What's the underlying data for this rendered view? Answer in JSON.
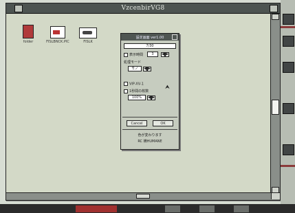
{
  "window": {
    "title": "VzcenbirVG8"
  },
  "desktop_icons": [
    {
      "label": "folder",
      "icon": "folder-icon"
    },
    {
      "label": "FISLBNCK.PIC",
      "icon": "document-icon"
    },
    {
      "label": "FISLK",
      "icon": "image-icon"
    }
  ],
  "dialog": {
    "title": "設定画面 ver1.00",
    "top_field": "7/30",
    "fields": {
      "field1_label": "表示時間",
      "field1_value": "3",
      "section_label": "処理モード",
      "mode_value": "モノ",
      "opt_a_label": "VIP-XV-1",
      "opt_b_label": "1秒間の枚数",
      "opt_b_value": "100%"
    },
    "buttons": {
      "cancel": "Cancel",
      "ok": "OK"
    },
    "footer_line1": "色が変わります",
    "footer_line2": "RC 横HUMANE"
  },
  "colors": {
    "titlebar": "#4d5451",
    "desktop": "#d3d9c7",
    "accent_red": "#b03a3a"
  }
}
